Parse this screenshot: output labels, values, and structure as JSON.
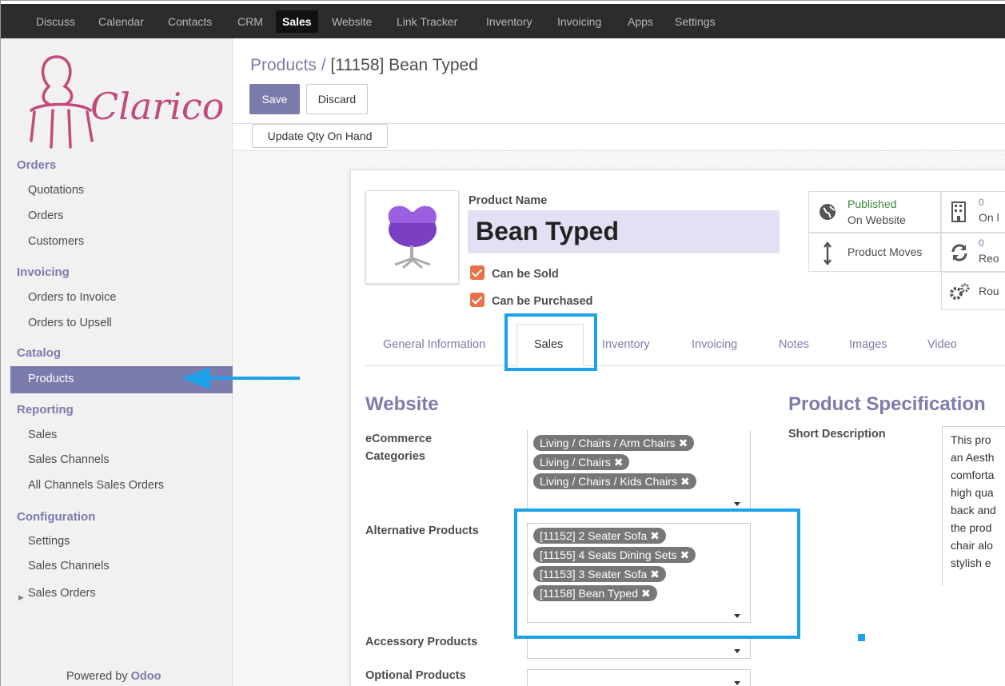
{
  "topnav": {
    "items": [
      "Discuss",
      "Calendar",
      "Contacts",
      "CRM",
      "Sales",
      "Website",
      "Link Tracker",
      "Inventory",
      "Invoicing",
      "Apps",
      "Settings"
    ],
    "active": "Sales"
  },
  "logo": {
    "text": "Clarico",
    "color": "#c24a7c"
  },
  "sidebar": {
    "sections": {
      "orders": "Orders",
      "invoicing": "Invoicing",
      "catalog": "Catalog",
      "reporting": "Reporting",
      "configuration": "Configuration"
    },
    "items": {
      "quotations": "Quotations",
      "orders": "Orders",
      "customers": "Customers",
      "orders_to_invoice": "Orders to Invoice",
      "orders_to_upsell": "Orders to Upsell",
      "products": "Products",
      "sales": "Sales",
      "sales_channels": "Sales Channels",
      "all_channels_sales_orders": "All Channels Sales Orders",
      "settings": "Settings",
      "config_sales_channels": "Sales Channels",
      "sales_orders": "Sales Orders"
    },
    "powered_prefix": "Powered by",
    "powered_brand": "Odoo"
  },
  "control": {
    "breadcrumb_parent": "Products /",
    "breadcrumb_current": "[11158] Bean Typed",
    "save": "Save",
    "discard": "Discard",
    "update_qty": "Update Qty On Hand"
  },
  "product": {
    "name_label": "Product Name",
    "name": "Bean Typed",
    "can_be_sold": "Can be Sold",
    "can_be_purchased": "Can be Purchased"
  },
  "smart_buttons": {
    "published_line1": "Published",
    "published_line2": "On Website",
    "product_moves": "Product Moves",
    "on_hand_count": "0",
    "on_hand_label": "On l",
    "reordering_count": "0",
    "reordering_label": "Reo",
    "routes_label": "Rou"
  },
  "tabs": [
    "General Information",
    "Sales",
    "Inventory",
    "Invoicing",
    "Notes",
    "Images",
    "Video"
  ],
  "website": {
    "title": "Website",
    "ecommerce_label_1": "eCommerce",
    "ecommerce_label_2": "Categories",
    "ecommerce_tags": [
      "Living / Chairs / Arm Chairs",
      "Living / Chairs",
      "Living / Chairs / Kids Chairs"
    ],
    "alternative_label": "Alternative Products",
    "alternative_tags": [
      "[11152] 2 Seater Sofa",
      "[11155] 4 Seats Dining Sets",
      "[11153] 3 Seater Sofa",
      "[11158] Bean Typed"
    ],
    "accessory_label": "Accessory Products",
    "optional_label": "Optional Products"
  },
  "specification": {
    "title": "Product Specification",
    "short_description_label": "Short Description",
    "short_description_lines": [
      "This pro",
      "an Aesth",
      "comforta",
      "high qua",
      "back and",
      "the prod",
      "chair alo",
      "stylish e"
    ]
  },
  "colors": {
    "brand": "#7c7bad",
    "annotation": "#1ea1e8",
    "checkbox": "#e8734a",
    "topbar": "#2c2c2c"
  }
}
